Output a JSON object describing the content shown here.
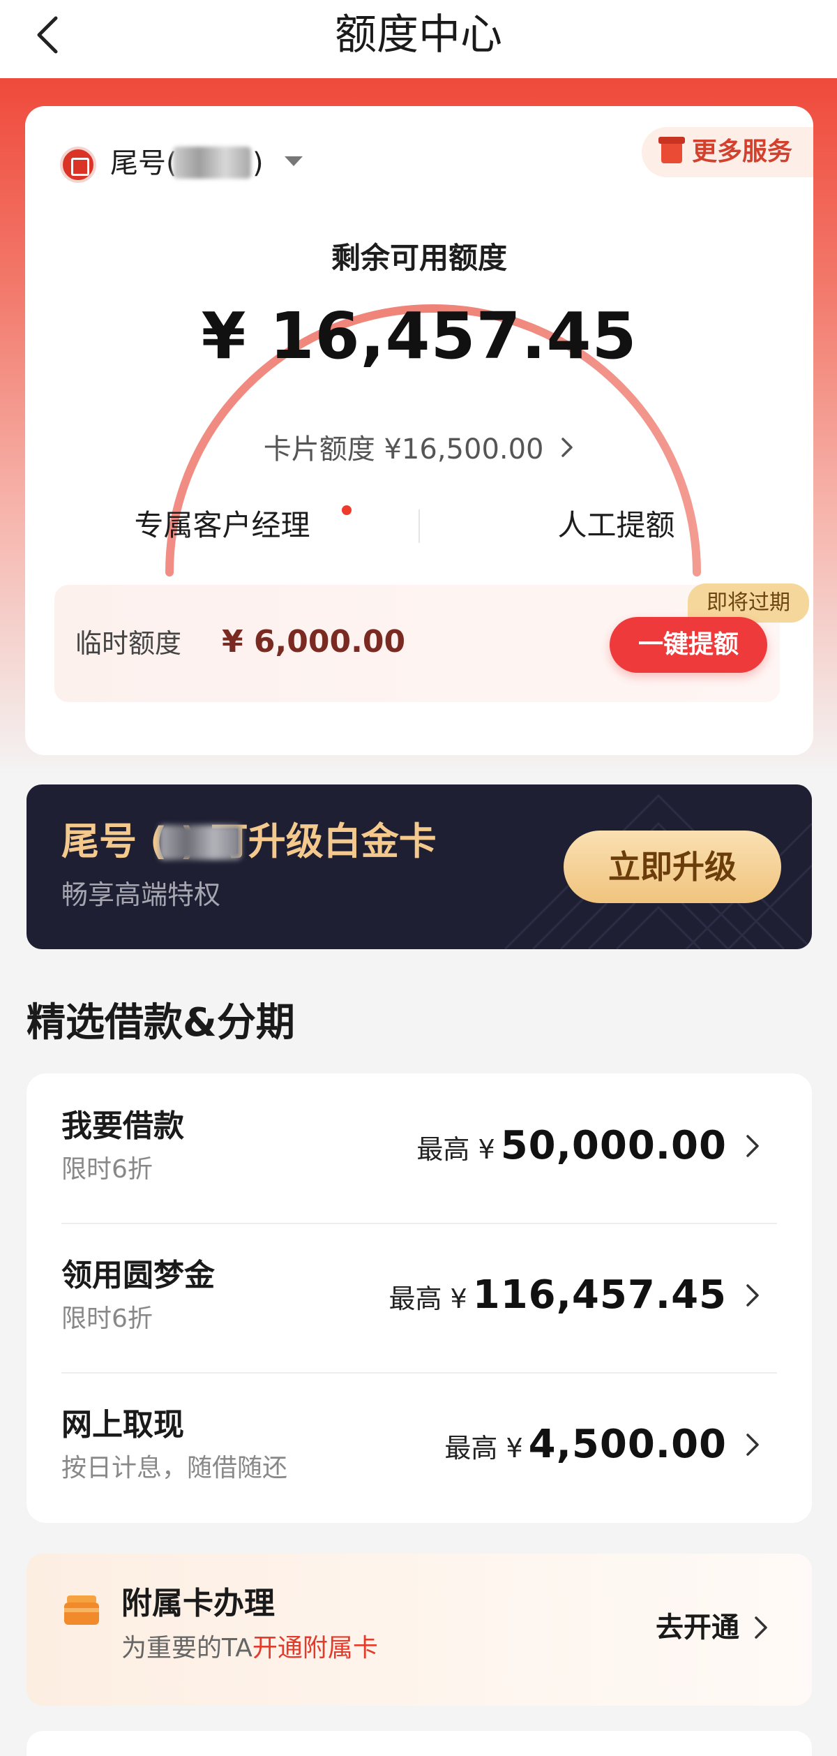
{
  "nav": {
    "title": "额度中心",
    "back_icon": "chevron-left-icon"
  },
  "account": {
    "tail_label": "尾号(",
    "tail_close": ")",
    "more_services": "更多服务"
  },
  "credit": {
    "remaining_label": "剩余可用额度",
    "remaining_amount": "¥ 16,457.45",
    "card_limit": "卡片额度 ¥16,500.00",
    "manager": "专属客户经理",
    "manual_raise": "人工提额"
  },
  "temp_limit": {
    "label": "临时额度",
    "amount": "¥ 6,000.00",
    "badge": "即将过期",
    "button": "一键提额"
  },
  "promo": {
    "title": "尾号 (        ) 可升级白金卡",
    "subtitle": "畅享高端特权",
    "button": "立即升级"
  },
  "section": {
    "title": "精选借款&分期"
  },
  "loans": [
    {
      "name": "我要借款",
      "sub": "限时6折",
      "prefix": "最高 ¥",
      "amount": "50,000.00"
    },
    {
      "name": "领用圆梦金",
      "sub": "限时6折",
      "prefix": "最高 ¥",
      "amount": "116,457.45"
    },
    {
      "name": "网上取现",
      "sub": "按日计息，随借随还",
      "prefix": "最高 ¥",
      "amount": "4,500.00"
    }
  ],
  "supplementary": {
    "title": "附属卡办理",
    "desc_plain": "为重要的TA",
    "desc_highlight": "开通附属卡",
    "action": "去开通"
  },
  "colors": {
    "brand_red": "#ee3a3a",
    "gold": "#f3c98d",
    "promo_bg": "#1e1f33"
  }
}
